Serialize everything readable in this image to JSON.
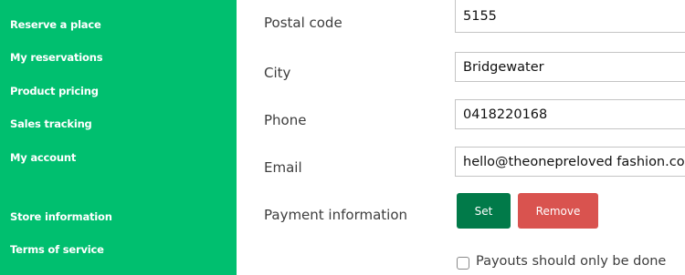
{
  "sidebar": {
    "items": [
      {
        "label": "Reserve a place"
      },
      {
        "label": "My reservations"
      },
      {
        "label": "Product pricing"
      },
      {
        "label": "Sales tracking"
      },
      {
        "label": "My account"
      },
      {
        "label": "Store information"
      },
      {
        "label": "Terms of service"
      }
    ]
  },
  "form": {
    "postal_code": {
      "label": "Postal code",
      "value": "5155"
    },
    "city": {
      "label": "City",
      "value": "Bridgewater"
    },
    "phone": {
      "label": "Phone",
      "value": "0418220168"
    },
    "email": {
      "label": "Email",
      "value": "hello@theonepreloved fashion.com"
    },
    "payment": {
      "label": "Payment information",
      "set_label": "Set",
      "remove_label": "Remove"
    },
    "payouts_checkbox": {
      "label": "Payouts should only be done",
      "checked": false
    }
  },
  "colors": {
    "sidebar_bg": "#00bf6f",
    "set_button": "#017a49",
    "remove_button": "#d9534f"
  }
}
